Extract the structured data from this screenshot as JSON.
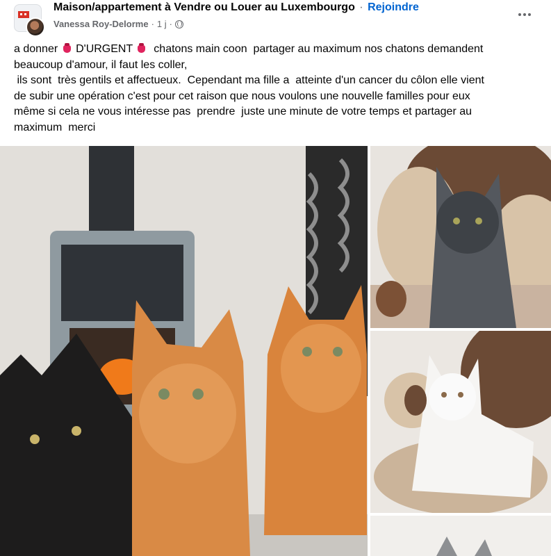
{
  "header": {
    "group_name": "Maison/appartement à Vendre ou Louer au Luxembourgo",
    "separator": "·",
    "join_label": "Rejoindre",
    "author": "Vanessa Roy-Delorme",
    "timestamp": "1 j",
    "meta_separator": "·",
    "audience_icon": "globe-icon",
    "more_icon": "more-options-icon"
  },
  "post": {
    "line1_a": "a donner",
    "line1_b": "D'URGENT",
    "line1_c": " chatons main coon  partager au maximum nos chatons demandent",
    "line2": "beaucoup d'amour, il faut les coller,",
    "line3": " ils sont  très gentils et affectueux.  Cependant ma fille a  atteinte d'un cancer du côlon elle vient",
    "line4": "de subir une opération c'est pour cet raison que nous voulons une nouvelle familles pour eux",
    "line5": "même si cela ne vous intéresse pas  prendre  juste une minute de votre temps et partager au",
    "line6": "maximum  merci",
    "emoji": "pushpin-emoji"
  },
  "photos": {
    "main": "three-kittens-photo",
    "side1": "grey-kitten-photo",
    "side2": "white-kitten-photo",
    "side3": "kitten-ears-photo"
  },
  "colors": {
    "link_blue": "#0064d1",
    "secondary_text": "#65676b",
    "text": "#050505"
  }
}
